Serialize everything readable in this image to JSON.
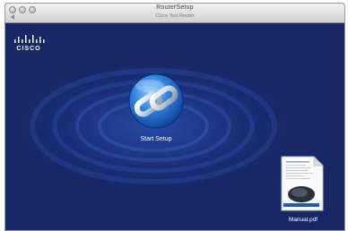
{
  "window": {
    "title": "RouterSetup",
    "subtitle": "Cisco Tool Router"
  },
  "brand": {
    "logo_text": "CISCO",
    "logo_color": "#ffffff"
  },
  "desktop": {
    "background_color": "#1d2b6c",
    "items": [
      {
        "label": "Start Setup",
        "icon": "chain-link-icon"
      },
      {
        "label": "Manual.pdf",
        "icon": "pdf-document-icon"
      }
    ]
  }
}
